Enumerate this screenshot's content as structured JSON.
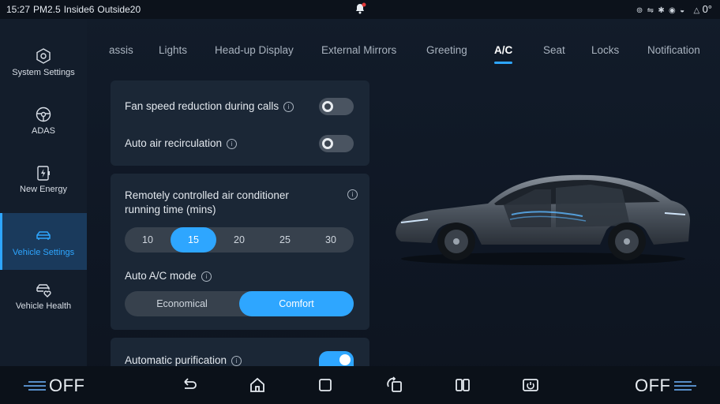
{
  "status": {
    "time": "15:27",
    "pm25": "PM2.5",
    "inside": "Inside6",
    "outside": "Outside20",
    "temp": "0°"
  },
  "sidebar": {
    "items": [
      {
        "label": "System Settings",
        "icon": "hexagon-gear-icon",
        "active": false
      },
      {
        "label": "ADAS",
        "icon": "steering-wheel-icon",
        "active": false
      },
      {
        "label": "New Energy",
        "icon": "battery-bolt-icon",
        "active": false
      },
      {
        "label": "Vehicle Settings",
        "icon": "car-icon",
        "active": true
      },
      {
        "label": "Vehicle Health",
        "icon": "car-heart-icon",
        "active": false
      }
    ]
  },
  "tabs": [
    "assis",
    "Lights",
    "Head-up Display",
    "External Mirrors",
    "Greeting",
    "A/C",
    "Seat",
    "Locks",
    "Notification"
  ],
  "active_tab": "A/C",
  "settings": {
    "fan_speed_reduction": {
      "label": "Fan speed reduction during calls",
      "on": false
    },
    "auto_recirculation": {
      "label": "Auto air recirculation",
      "on": false
    },
    "remote_runtime": {
      "label_line1": "Remotely controlled air conditioner",
      "label_line2": "running time (mins)",
      "options": [
        "10",
        "15",
        "20",
        "25",
        "30"
      ],
      "selected": "15"
    },
    "auto_ac_mode": {
      "label": "Auto A/C mode",
      "options": [
        "Economical",
        "Comfort"
      ],
      "selected": "Comfort"
    },
    "auto_purification": {
      "label": "Automatic purification",
      "on": true
    }
  },
  "bottom": {
    "left_off": "OFF",
    "right_off": "OFF"
  },
  "colors": {
    "accent": "#2ea6ff",
    "background": "#0f1825",
    "card": "#1b2736"
  }
}
